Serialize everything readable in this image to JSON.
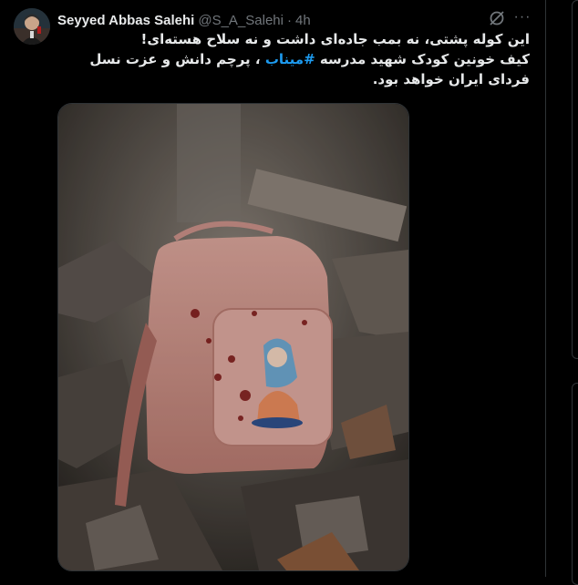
{
  "tweet": {
    "author_name": "Seyyed Abbas Salehi",
    "author_handle": "@S_A_Salehi",
    "separator": "·",
    "time": "4h",
    "more_label": "···",
    "line1": "این کوله پشتی، نه بمب جاده‌ای داشت و نه سلاح هسته‌ای!",
    "line2_before": "کیف خونین کودک شهید مدرسه ",
    "hashtag": "#میناب",
    "line2_after": " ، پرچم دانش و عزت نسل فردای ایران خواهد بود.",
    "icons": {
      "grok": "grok-icon",
      "more": "more-icon"
    }
  },
  "colors": {
    "background": "#000000",
    "text": "#e7e9ea",
    "muted": "#71767b",
    "link": "#1d9bf0",
    "border": "#2f3336"
  }
}
